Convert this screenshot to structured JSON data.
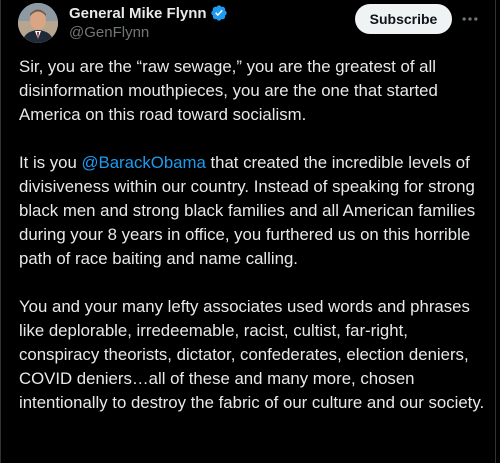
{
  "author": {
    "display_name": "General Mike Flynn",
    "handle": "@GenFlynn",
    "verified": true
  },
  "actions": {
    "subscribe_label": "Subscribe",
    "more_icon": "ellipsis-horizontal-icon"
  },
  "post": {
    "paragraph_1": "Sir, you are the “raw sewage,” you are the greatest of all disinformation mouthpieces, you are the one that started America on this road toward socialism.",
    "paragraph_2_before": "It is you ",
    "paragraph_2_mention": "@BarackObama",
    "paragraph_2_after": " that created the incredible levels of divisiveness within our country. Instead of speaking for strong black men and strong black families and all American families during your 8 years in office, you furthered us on this horrible path of race baiting and name calling.",
    "paragraph_3": "You and your many lefty associates used words and phrases like deplorable, irredeemable, racist, cultist, far-right, conspiracy theorists, dictator, confederates, election deniers, COVID deniers…all of these and many more, chosen intentionally to destroy the fabric of our culture and our society."
  },
  "colors": {
    "background": "#000000",
    "text": "#e7e9ea",
    "secondary_text": "#71767b",
    "link": "#1d9bf0",
    "verified_badge": "#1d9bf0",
    "subscribe_bg": "#eff3f4"
  }
}
